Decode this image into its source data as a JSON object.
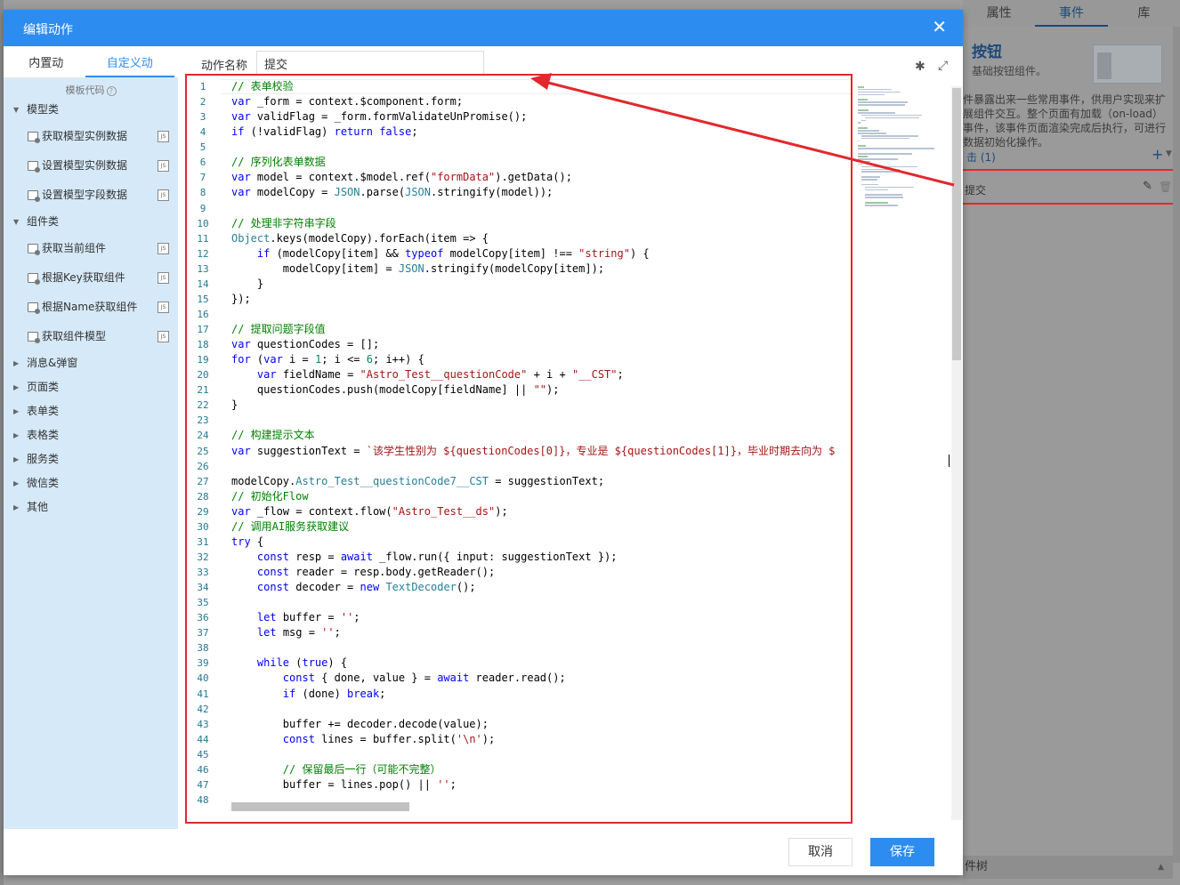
{
  "background": {
    "tabs": [
      "属性",
      "事件",
      "库"
    ],
    "active_tab": "事件",
    "component_title": "按钮",
    "component_subtitle": "基础按钮组件。",
    "description": "件暴露出来一些常用事件，供用户实现来扩展组件交互。整个页面有加载（on-load）事件，该事件页面渲染完成后执行，可进行数据初始化操作。",
    "event_group_label": "击 (1)",
    "event_item_label": "提交",
    "bottom_label": "件树"
  },
  "modal": {
    "title": "编辑动作",
    "close_icon": "close-icon",
    "left_tabs": [
      "内置动作",
      "自定义动作"
    ],
    "active_left_tab": "自定义动作",
    "template_header": "模板代码",
    "tree": [
      {
        "type": "cat",
        "label": "模型类",
        "expanded": true
      },
      {
        "type": "leaf",
        "label": "获取模型实例数据"
      },
      {
        "type": "leaf",
        "label": "设置模型实例数据"
      },
      {
        "type": "leaf",
        "label": "设置模型字段数据"
      },
      {
        "type": "cat",
        "label": "组件类",
        "expanded": true
      },
      {
        "type": "leaf",
        "label": "获取当前组件"
      },
      {
        "type": "leaf",
        "label": "根据Key获取组件"
      },
      {
        "type": "leaf",
        "label": "根据Name获取组件"
      },
      {
        "type": "leaf",
        "label": "获取组件模型"
      },
      {
        "type": "cat",
        "label": "消息&弹窗",
        "expanded": false
      },
      {
        "type": "cat",
        "label": "页面类",
        "expanded": false
      },
      {
        "type": "cat",
        "label": "表单类",
        "expanded": false
      },
      {
        "type": "cat",
        "label": "表格类",
        "expanded": false
      },
      {
        "type": "cat",
        "label": "服务类",
        "expanded": false
      },
      {
        "type": "cat",
        "label": "微信类",
        "expanded": false
      },
      {
        "type": "cat",
        "label": "其他",
        "expanded": false
      }
    ],
    "action_name_label": "动作名称",
    "action_name_value": "提交",
    "code_lines": [
      "// 表单校验",
      "var _form = context.$component.form;",
      "var validFlag = _form.formValidateUnPromise();",
      "if (!validFlag) return false;",
      "",
      "// 序列化表单数据",
      "var model = context.$model.ref(\"formData\").getData();",
      "var modelCopy = JSON.parse(JSON.stringify(model));",
      "",
      "// 处理非字符串字段",
      "Object.keys(modelCopy).forEach(item => {",
      "    if (modelCopy[item] && typeof modelCopy[item] !== \"string\") {",
      "        modelCopy[item] = JSON.stringify(modelCopy[item]);",
      "    }",
      "});",
      "",
      "// 提取问题字段值",
      "var questionCodes = [];",
      "for (var i = 1; i <= 6; i++) {",
      "    var fieldName = \"Astro_Test__questionCode\" + i + \"__CST\";",
      "    questionCodes.push(modelCopy[fieldName] || \"\");",
      "}",
      "",
      "// 构建提示文本",
      "var suggestionText = `该学生性别为 ${questionCodes[0]}，专业是 ${questionCodes[1]}，毕业时期去向为 $",
      "",
      "modelCopy.Astro_Test__questionCode7__CST = suggestionText;",
      "// 初始化Flow",
      "var _flow = context.flow(\"Astro_Test__ds\");",
      "// 调用AI服务获取建议",
      "try {",
      "    const resp = await _flow.run({ input: suggestionText });",
      "    const reader = resp.body.getReader();",
      "    const decoder = new TextDecoder();",
      "",
      "    let buffer = '';",
      "    let msg = '';",
      "",
      "    while (true) {",
      "        const { done, value } = await reader.read();",
      "        if (done) break;",
      "",
      "        buffer += decoder.decode(value);",
      "        const lines = buffer.split('\\n');",
      "",
      "        // 保留最后一行（可能不完整）",
      "        buffer = lines.pop() || '';",
      ""
    ],
    "cancel_label": "取消",
    "save_label": "保存"
  },
  "colors": {
    "accent": "#2d8cf0",
    "highlight": "#e3272d",
    "tree_bg": "#d6e9f8"
  }
}
